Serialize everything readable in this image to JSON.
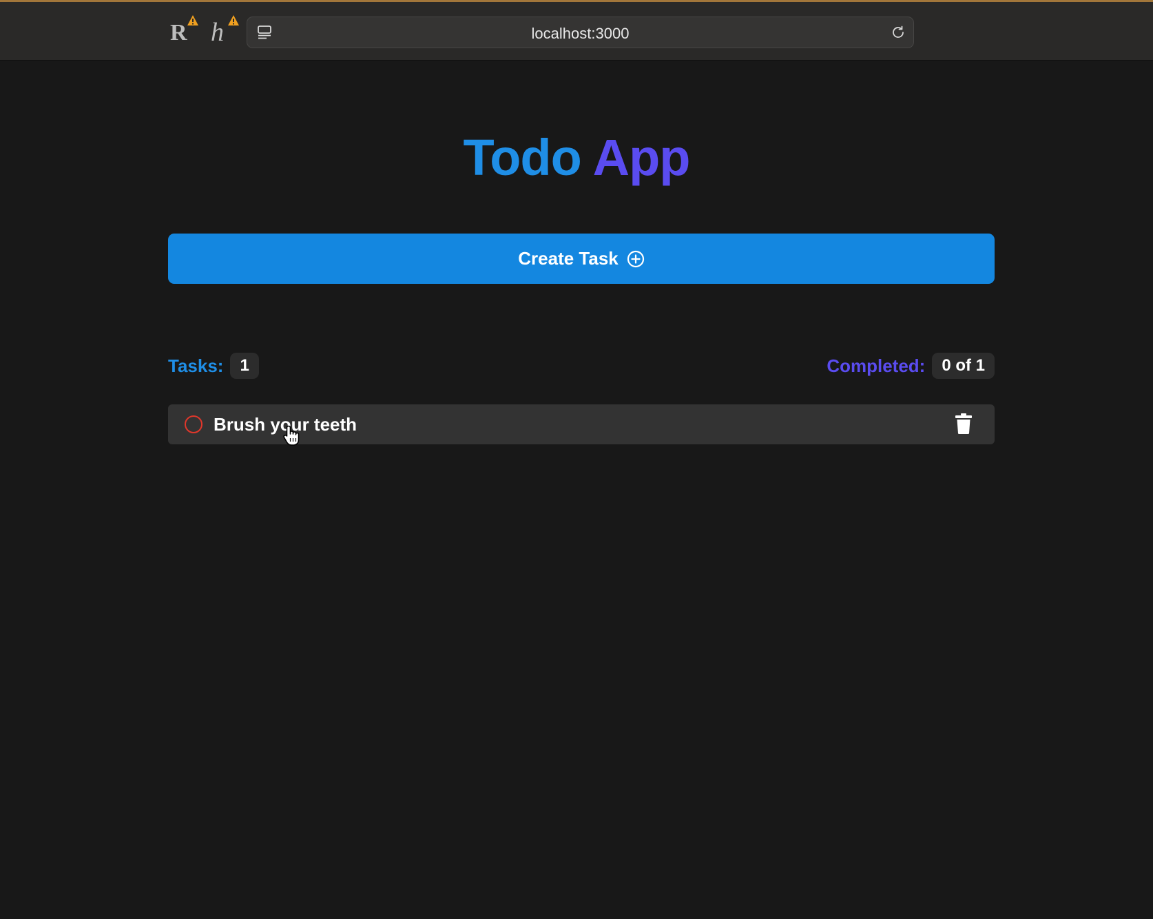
{
  "browser": {
    "url": "localhost:3000",
    "extensions": [
      {
        "letter": "R",
        "icon": "r-extension-icon",
        "warning": true
      },
      {
        "letter": "h",
        "icon": "h-extension-icon",
        "warning": true
      }
    ]
  },
  "app": {
    "title_part1": "Todo",
    "title_part2": "App",
    "create_button_label": "Create Task",
    "tasks_label": "Tasks:",
    "tasks_count": "1",
    "completed_label": "Completed:",
    "completed_value": "0 of 1"
  },
  "tasks": [
    {
      "text": "Brush your teeth",
      "completed": false
    }
  ],
  "colors": {
    "background": "#181818",
    "accent_blue": "#1f8ee6",
    "accent_purple": "#5a4cf0",
    "button_blue": "#1487e0",
    "task_row": "#333333",
    "incomplete_circle": "#e0372b"
  }
}
